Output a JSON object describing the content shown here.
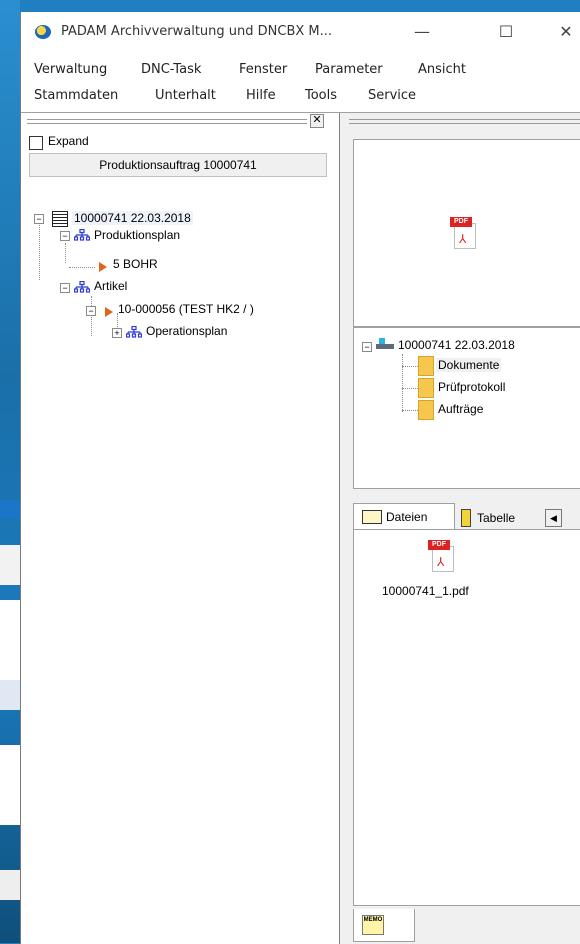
{
  "window": {
    "title": "PADAM Archivverwaltung und DNCBX M...",
    "minimize": "—",
    "maximize": "☐",
    "close": "✕"
  },
  "menu_row1": [
    "Verwaltung",
    "DNC-Task",
    "Fenster",
    "Parameter",
    "Ansicht"
  ],
  "menu_row2": [
    "Stammdaten",
    "Unterhalt",
    "Hilfe",
    "Tools",
    "Service"
  ],
  "left": {
    "close_glyph": "✕",
    "expand_label": "Expand",
    "header": "Produktionsauftrag  10000741",
    "tree": {
      "root": "10000741 22.03.2018",
      "produktionsplan": "Produktionsplan",
      "bohr": "5 BOHR",
      "artikel": "Artikel",
      "article_item": "10-000056 (TEST HK2 / )",
      "operationsplan": "Operationsplan"
    }
  },
  "right": {
    "pdf_tag": "PDF",
    "doc_tree": {
      "root": "10000741 22.03.2018",
      "items": [
        "Dokumente",
        "Prüfprotokoll",
        "Aufträge"
      ]
    },
    "tabs": {
      "dateien": "Dateien",
      "tabelle": "Tabelle"
    },
    "files": [
      {
        "name": "10000741_1.pdf"
      }
    ],
    "memo_label": "MEMO"
  }
}
